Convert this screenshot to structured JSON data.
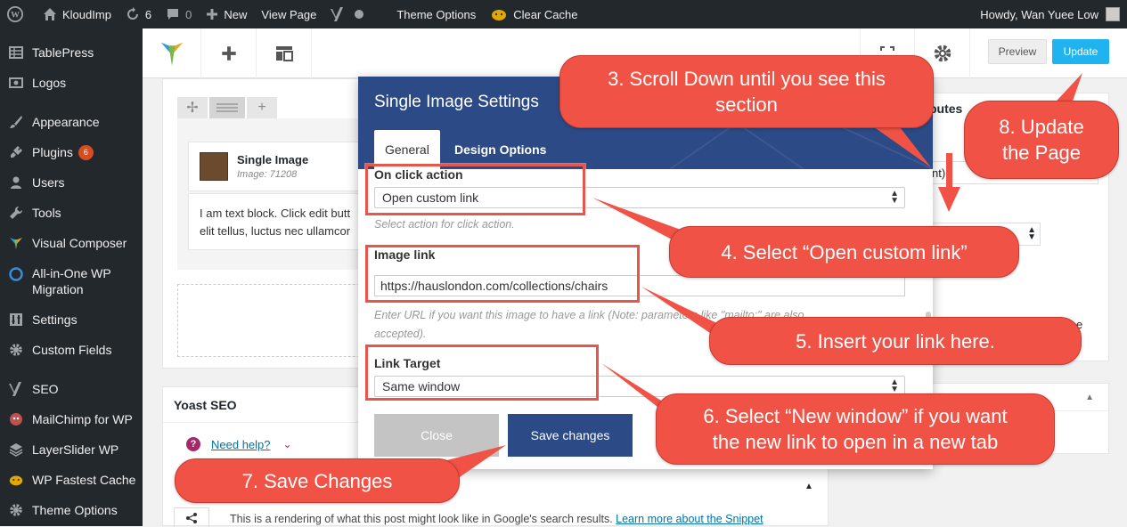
{
  "adminbar": {
    "site_name": "KloudImp",
    "updates_count": "6",
    "comments_count": "0",
    "new_label": "New",
    "view_page_label": "View Page",
    "theme_options_label": "Theme Options",
    "clear_cache_label": "Clear Cache",
    "howdy": "Howdy, Wan Yuee Low"
  },
  "sidebar": {
    "items": [
      {
        "label": "TablePress",
        "icon": "table-icon"
      },
      {
        "label": "Logos",
        "icon": "image-icon"
      },
      {
        "label": "Appearance",
        "icon": "brush-icon"
      },
      {
        "label": "Plugins",
        "icon": "plug-icon",
        "badge": "6"
      },
      {
        "label": "Users",
        "icon": "user-icon"
      },
      {
        "label": "Tools",
        "icon": "wrench-icon"
      },
      {
        "label": "Visual Composer",
        "icon": "vc-icon"
      },
      {
        "label": "All-in-One WP",
        "label2": "Migration",
        "icon": "migration-icon"
      },
      {
        "label": "Settings",
        "icon": "settings-icon"
      },
      {
        "label": "Custom Fields",
        "icon": "gear-icon"
      },
      {
        "label": "SEO",
        "icon": "yoast-icon"
      },
      {
        "label": "MailChimp for WP",
        "icon": "mailchimp-icon"
      },
      {
        "label": "LayerSlider WP",
        "icon": "layers-icon"
      },
      {
        "label": "WP Fastest Cache",
        "icon": "cheetah-icon"
      },
      {
        "label": "Theme Options",
        "icon": "gear-icon"
      }
    ]
  },
  "toolbar": {
    "preview_label": "Preview",
    "update_label": "Update"
  },
  "editor": {
    "single_image_title": "Single Image",
    "single_image_sub": "Image: 71208",
    "text_block_line1": "I am text block. Click edit butt",
    "text_block_line2": "elit tellus, luctus nec ullamcor"
  },
  "yoast": {
    "title": "Yoast SEO",
    "help_label": "Need help?",
    "snippet_text": "This is a rendering of what this post might look like in Google's search results.",
    "snippet_link": "Learn more about the Snippet"
  },
  "right_panel": {
    "heading_fragment": "butes",
    "field_fragment": "nt)",
    "e_fragment": "e"
  },
  "modal": {
    "title": "Single Image Settings",
    "tabs": [
      "General",
      "Design Options"
    ],
    "on_click_label": "On click action",
    "on_click_value": "Open custom link",
    "on_click_hint": "Select action for click action.",
    "image_link_label": "Image link",
    "image_link_value": "https://hauslondon.com/collections/chairs",
    "image_link_hint_1": "Enter URL if you want this image to have a link (Note: parameters like \"mailto:\" are also",
    "image_link_hint_2": "accepted).",
    "link_target_label": "Link Target",
    "link_target_value": "Same window",
    "close_label": "Close",
    "save_label": "Save changes"
  },
  "callouts": {
    "step3_line1": "3. Scroll Down until you see this",
    "step3_line2": "section",
    "step4": "4. Select “Open custom link”",
    "step5": "5. Insert your link here.",
    "step6_line1": "6. Select “New window” if you want",
    "step6_line2": "the new link to open in a new tab",
    "step7": "7. Save Changes",
    "step8_line1": "8. Update",
    "step8_line2": "the Page"
  },
  "colors": {
    "adminbar_bg": "#23282d",
    "modal_header": "#2b4a86",
    "update_button": "#1fb3f0",
    "callout_red": "#f05346",
    "plugin_badge": "#d54e21"
  }
}
